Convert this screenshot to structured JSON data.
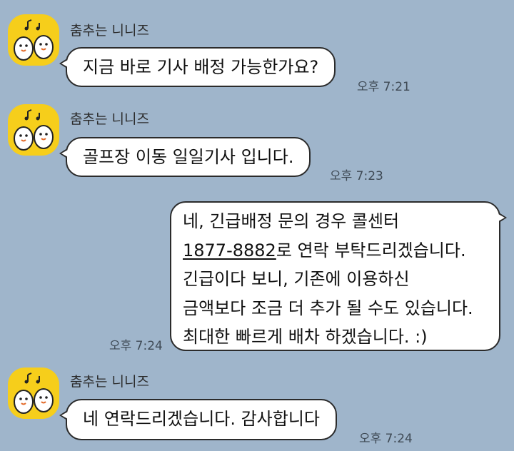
{
  "messages": [
    {
      "sender": "춤추는 니니즈",
      "text": "지금 바로 기사 배정 가능한가요?",
      "time": "오후 7:21"
    },
    {
      "sender": "춤추는 니니즈",
      "text": "골프장 이동 일일기사 입니다.",
      "time": "오후 7:23"
    },
    {
      "phone": "1877-8882",
      "lines": [
        "네, 긴급배정 문의 경우 콜센터",
        "로 연락 부탁드리겠습니다.",
        "긴급이다 보니, 기존에 이용하신",
        "금액보다 조금 더 추가 될 수도 있습니다.",
        "최대한 빠르게 배차 하겠습니다. :)"
      ],
      "time": "오후 7:24"
    },
    {
      "sender": "춤추는 니니즈",
      "text": "네 연락드리겠습니다. 감사합니다",
      "time": "오후 7:24"
    }
  ],
  "colors": {
    "background": "#9fb5cb",
    "avatar": "#f6ce1b",
    "bubble": "#ffffff",
    "outline": "#2b2b2b"
  },
  "icons": {
    "avatar": "dancing-niniz-avatar-icon"
  }
}
